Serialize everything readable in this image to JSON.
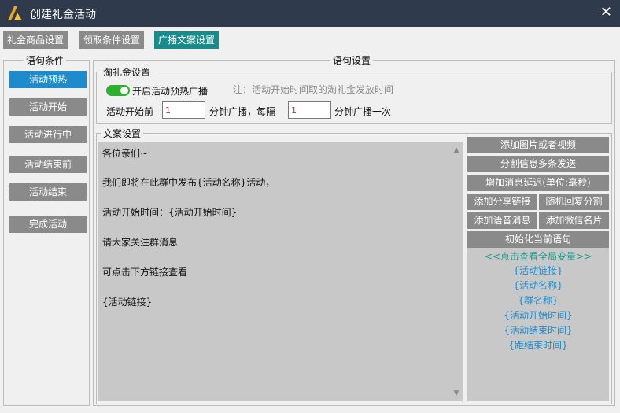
{
  "window": {
    "title": "创建礼金活动",
    "close_glyph": "✕"
  },
  "tabs": [
    {
      "label": "礼金商品设置"
    },
    {
      "label": "领取条件设置"
    },
    {
      "label": "广播文案设置"
    }
  ],
  "sidebar": {
    "title": "语句条件",
    "items": [
      {
        "label": "活动预热"
      },
      {
        "label": "活动开始"
      },
      {
        "label": "活动进行中"
      },
      {
        "label": "活动结束前"
      },
      {
        "label": "活动结束"
      },
      {
        "label": "完成活动"
      }
    ]
  },
  "settings": {
    "title": "语句设置",
    "taolijin": {
      "title": "淘礼金设置",
      "toggle_label": "开启活动预热广播",
      "toggle_on": true,
      "note": "注：活动开始时间取的淘礼金发放时间",
      "before_label": "活动开始前",
      "before_value": "1",
      "mid_label": "分钟广播，每隔",
      "interval_value": "1",
      "after_label": "分钟广播一次"
    },
    "copy": {
      "title": "文案设置",
      "lines": [
        "各位亲们~",
        "我们即将在此群中发布{活动名称}活动，",
        "活动开始时间：{活动开始时间}",
        "请大家关注群消息",
        "可点击下方链接查看",
        "{活动链接}"
      ]
    }
  },
  "actions": {
    "add_media": "添加图片或者视频",
    "split_send": "分割信息多条发送",
    "add_delay": "增加消息延迟(单位:毫秒)",
    "add_share_link": "添加分享链接",
    "random_reply": "随机回复分割",
    "add_voice": "添加语音消息",
    "add_wechat_card": "添加微信名片",
    "init_sentence": "初始化当前语句"
  },
  "variables": {
    "header": "<<点击查看全局变量>>",
    "items": [
      "{活动链接}",
      "{活动名称}",
      "{群名称}",
      "{活动开始时间}",
      "{活动结束时间}",
      "{距结束时间}"
    ]
  },
  "colors": {
    "titlebar": "#2f3a4d",
    "tab_active": "#1a8a8a",
    "sidebar_active": "#1e8ccc",
    "toggle_on": "#2db02d",
    "button_gray": "#8a8a8a",
    "variable_text": "#1e8ccc"
  }
}
